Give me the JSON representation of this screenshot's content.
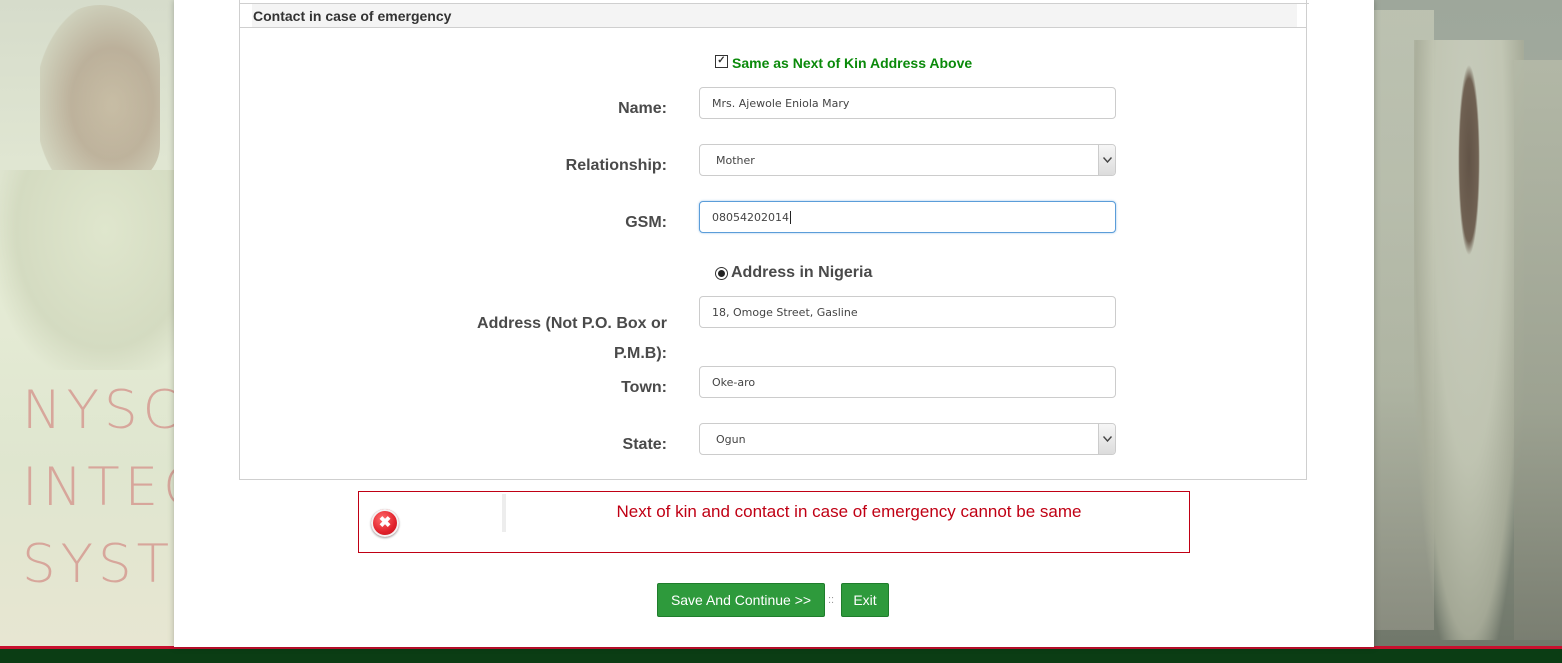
{
  "background": {
    "brand_lines": [
      "NYSC",
      "INTEG",
      "SYST"
    ]
  },
  "section": {
    "legend": "Contact in case of emergency"
  },
  "same_as_checkbox": {
    "label": "Same as Next of Kin Address Above",
    "checked": true,
    "color": "#0a8a0a"
  },
  "form": {
    "name_label": "Name:",
    "name_value": "Mrs. Ajewole Eniola Mary",
    "relationship_label": "Relationship:",
    "relationship_value": "Mother",
    "gsm_label": "GSM:",
    "gsm_value": "08054202014",
    "address_option_label": "Address in Nigeria",
    "address_label_line1": "Address (Not P.O. Box or",
    "address_label_line2": "P.M.B):",
    "address_value": "18, Omoge Street, Gasline",
    "town_label": "Town:",
    "town_value": "Oke-aro",
    "state_label": "State:",
    "state_value": "Ogun"
  },
  "error": {
    "message": "Next of kin and contact in case of emergency cannot be same",
    "color": "#c00014",
    "icon": "close-icon"
  },
  "actions": {
    "save_label": "Save And Continue >>",
    "separator": "::",
    "exit_label": "Exit",
    "button_color": "#2e9a3c"
  }
}
